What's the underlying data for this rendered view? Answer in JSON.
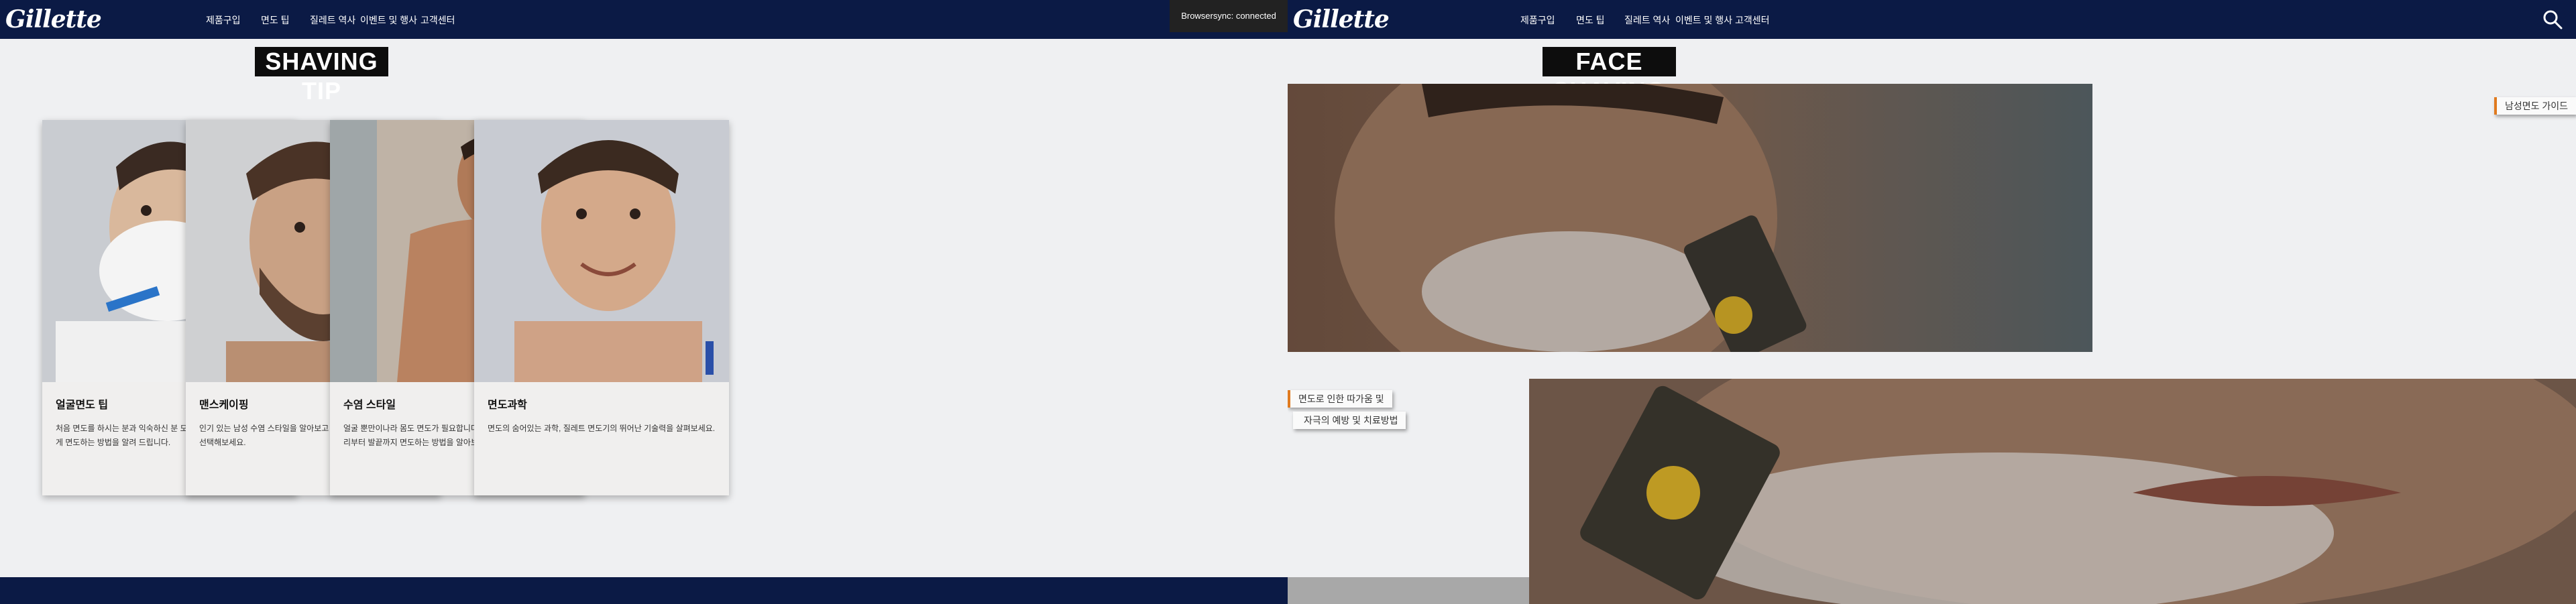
{
  "left": {
    "brand": "Gillette",
    "nav": [
      "제품구입",
      "면도 팁",
      "질레트 역사",
      "이벤트 및 행사",
      "고객센터"
    ],
    "section_title": "SHAVING TIP",
    "cards": [
      {
        "title": "얼굴면도 팁",
        "desc": "처음 면도를 하시는 분과 익숙하신 분 모두에게 더욱 매끄럽고 편안하게 면도하는 방법을 알려 드립니다.",
        "image": "man-shaving-foam-photo"
      },
      {
        "title": "맨스케이핑",
        "desc": "인기 있는 남성 수염 스타일을 알아보고 나에게 맞는 수염 스타일을 선택해보세요.",
        "image": "bearded-man-photo"
      },
      {
        "title": "수염 스타일",
        "desc": "얼굴 뿐만이나라 몸도 면도가 필요합니다. 질레트 스타일러와 함께 머리부터 발끝까지 면도하는 방법을 알아보세요.",
        "image": "shirtless-man-trimmer-photo"
      },
      {
        "title": "면도과학",
        "desc": "면도의 숨어있는 과학, 질레트 면도기의 뛰어난 기술력을 살펴보세요.",
        "image": "smiling-man-photo"
      }
    ],
    "badge": "Browsersync: connected",
    "colors": {
      "nav": "#0b1a45",
      "footer": "#0b1a45"
    }
  },
  "right": {
    "brand": "Gillette",
    "nav": [
      "제품구입",
      "면도 팁",
      "질레트 역사",
      "이벤트 및 행사",
      "고객센터"
    ],
    "section_title": "FACE SHAVING",
    "guide_tag": "남성면도 가이드",
    "tags": [
      "면도로 인한 따가움 및",
      "자극의 예방 및 치료방법"
    ],
    "images": [
      "man-shaving-cheek-closeup-photo",
      "razor-on-chin-closeup-photo"
    ],
    "colors": {
      "accent": "#e07a1f",
      "footer": "#a8a8a8"
    }
  }
}
